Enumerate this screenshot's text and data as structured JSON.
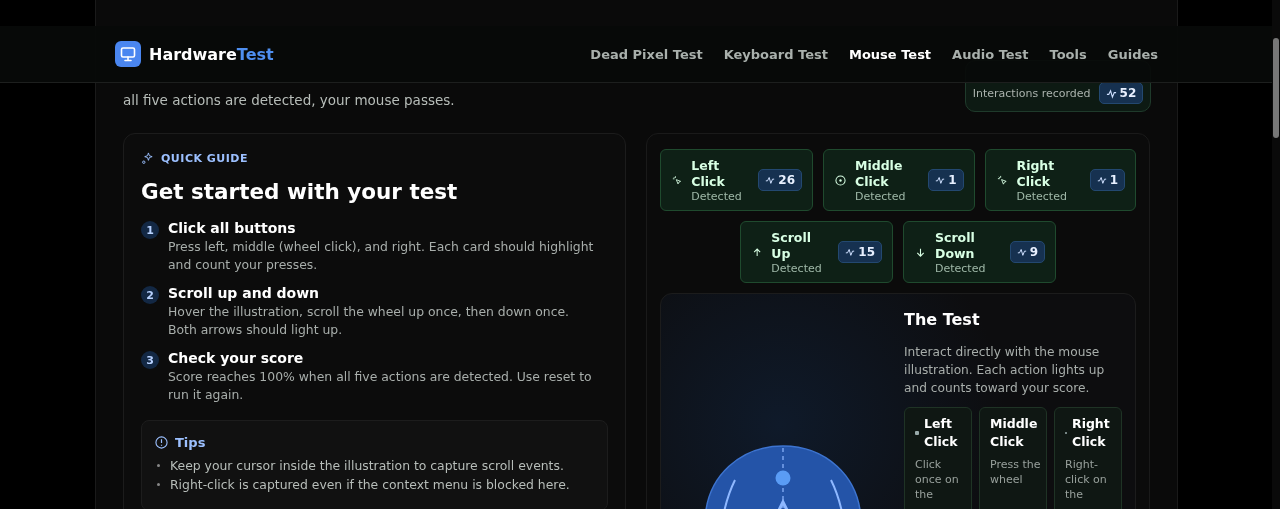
{
  "header": {
    "brand": "Hardware",
    "brand_accent": "Test",
    "nav": [
      {
        "label": "Dead Pixel Test",
        "selected": false
      },
      {
        "label": "Keyboard Test",
        "selected": false
      },
      {
        "label": "Mouse Test",
        "selected": true
      },
      {
        "label": "Audio Test",
        "selected": false
      },
      {
        "label": "Tools",
        "selected": false
      },
      {
        "label": "Guides",
        "selected": false
      }
    ]
  },
  "intro": "all five actions are detected, your mouse passes.",
  "stats": {
    "label": "Interactions recorded",
    "count": "52"
  },
  "guide": {
    "eyebrow": "QUICK GUIDE",
    "title": "Get started with your test",
    "steps": [
      {
        "number": "1",
        "title": "Click all buttons",
        "text": "Press left, middle (wheel click), and right. Each card should highlight and count your presses."
      },
      {
        "number": "2",
        "title": "Scroll up and down",
        "text": "Hover the illustration, scroll the wheel up once, then down once. Both arrows should light up."
      },
      {
        "number": "3",
        "title": "Check your score",
        "text": "Score reaches 100% when all five actions are detected. Use reset to run it again."
      }
    ],
    "tips": {
      "title": "Tips",
      "items": [
        "Keep your cursor inside the illustration to capture scroll events.",
        "Right-click is captured even if the context menu is blocked here."
      ]
    }
  },
  "actions": [
    {
      "kind": "left",
      "title": "Left Click",
      "status": "Detected",
      "count": "26",
      "detected": true
    },
    {
      "kind": "middle",
      "title": "Middle Click",
      "status": "Detected",
      "count": "1",
      "detected": true
    },
    {
      "kind": "right",
      "title": "Right Click",
      "status": "Detected",
      "count": "1",
      "detected": true
    },
    {
      "kind": "up",
      "title": "Scroll Up",
      "status": "Detected",
      "count": "15",
      "detected": true
    },
    {
      "kind": "down",
      "title": "Scroll Down",
      "status": "Detected",
      "count": "9",
      "detected": true
    }
  ],
  "test": {
    "title": "The Test",
    "text": "Interact directly with the mouse illustration. Each action lights up and counts toward your score.",
    "cards": [
      {
        "kind": "left",
        "title": "Left Click",
        "text": "Click once on the"
      },
      {
        "kind": "middle",
        "title": "Middle Click",
        "text": "Press the wheel"
      },
      {
        "kind": "right",
        "title": "Right Click",
        "text": "Right-click on the"
      }
    ]
  }
}
